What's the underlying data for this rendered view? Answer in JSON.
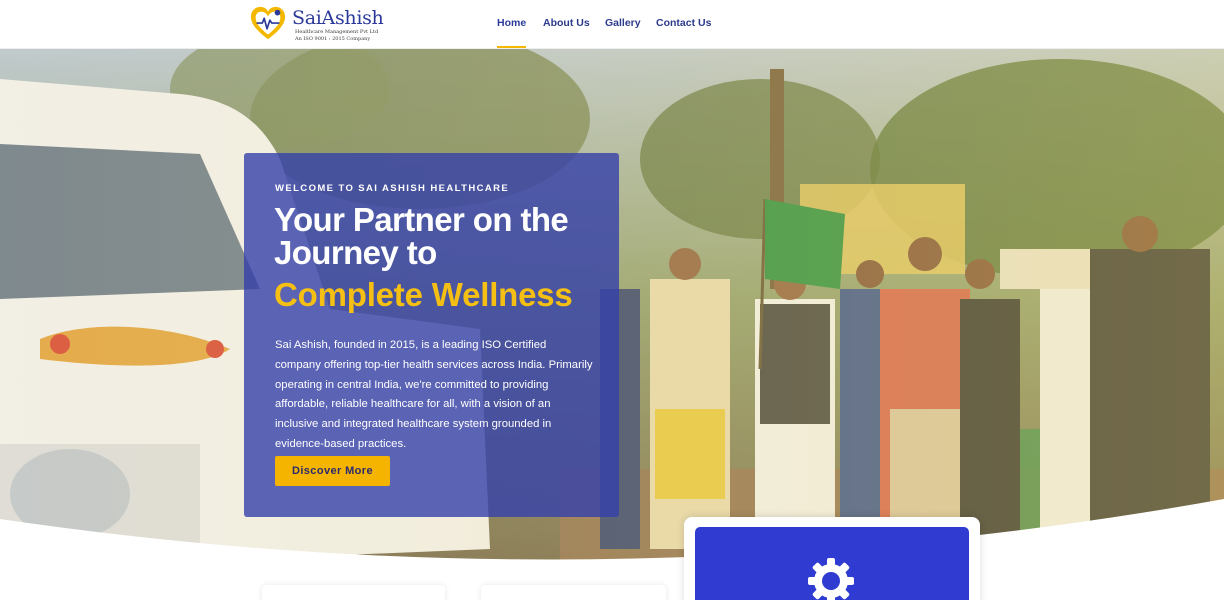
{
  "brand": {
    "name": "SaiAshish",
    "subtitle": "Healthcare Management Pvt Ltd",
    "iso_line": "An ISO 9001 : 2015 Company",
    "colors": {
      "primary": "#2b3a9a",
      "accent": "#f5b800"
    }
  },
  "nav": {
    "items": [
      {
        "label": "Home",
        "active": true
      },
      {
        "label": "About Us",
        "active": false
      },
      {
        "label": "Gallery",
        "active": false
      },
      {
        "label": "Contact Us",
        "active": false
      }
    ]
  },
  "hero": {
    "eyebrow": "WELCOME TO SAI ASHISH HEALTHCARE",
    "headline": "Your Partner on the Journey to",
    "headline_accent": "Complete Wellness",
    "description": "Sai Ashish, founded in 2015, is a leading ISO Certified company offering top-tier health services across India. Primarily operating in central India, we're committed to providing affordable, reliable healthcare for all, with a vision of an inclusive and integrated healthcare system grounded in evidence-based practices.",
    "cta_label": "Discover More",
    "background": "photo-ambulance-flag-off-ceremony"
  },
  "features": {
    "icon": "gear-icon",
    "card_color": "#2f3bd1"
  }
}
